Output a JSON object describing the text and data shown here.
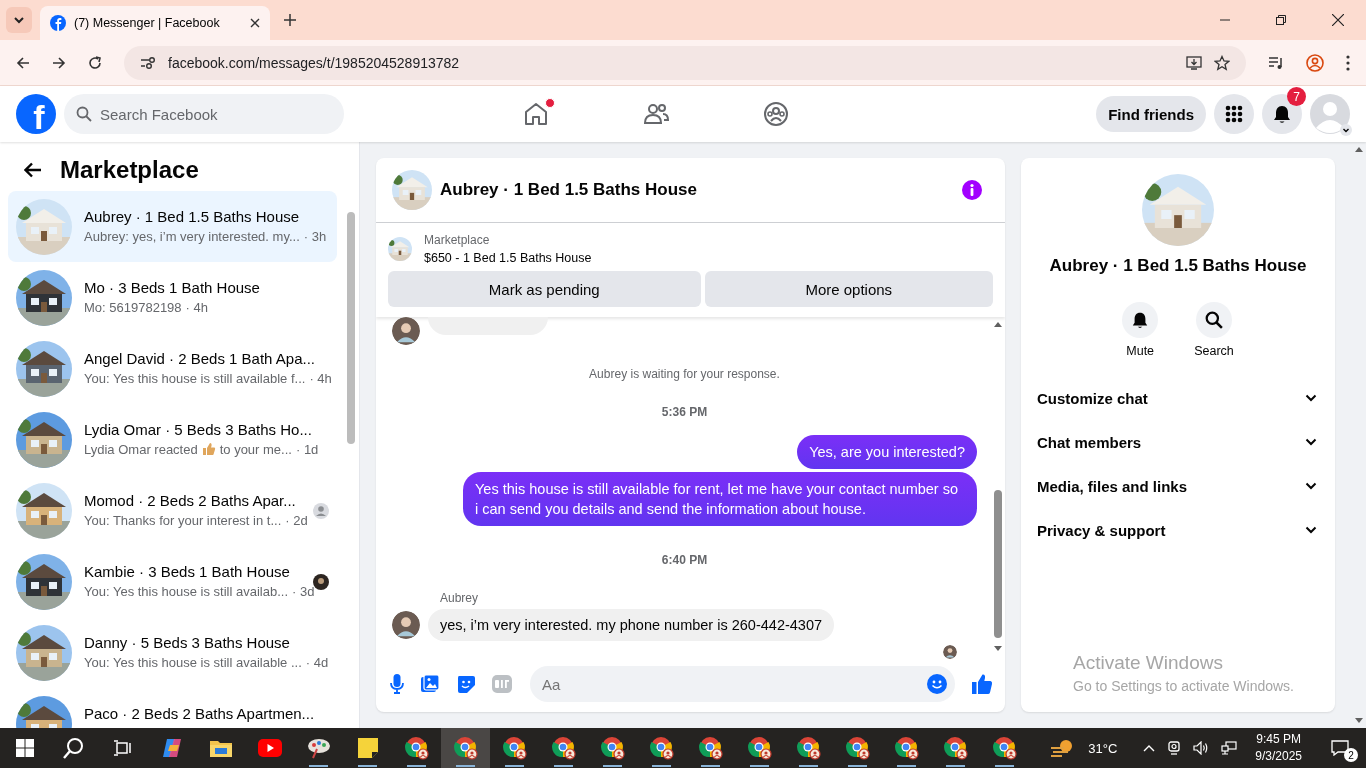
{
  "browser": {
    "tabs": [
      {
        "title": "(7) Messenger | Facebook",
        "selected": true
      }
    ],
    "url": "facebook.com/messages/t/1985204528913782"
  },
  "header": {
    "logo_text": "f",
    "search_placeholder": "Search Facebook",
    "nav": [
      {
        "kind": "home",
        "notification": true
      },
      {
        "kind": "friends",
        "notification": false
      },
      {
        "kind": "groups",
        "notification": false
      }
    ],
    "find_friends": "Find friends",
    "notification_count": "7"
  },
  "sidebar": {
    "title": "Marketplace",
    "conversations": [
      {
        "name": "Aubrey · 1 Bed 1.5 Baths House",
        "preview": "Aubrey: yes, i’m very interested. my...",
        "time": "· 3h",
        "selected": true,
        "reaction": false
      },
      {
        "name": "Mo · 3 Beds 1 Bath House",
        "preview": "Mo: 5619782198",
        "time": "· 4h",
        "selected": false,
        "reaction": false
      },
      {
        "name": "Angel David · 2 Beds 1 Bath Apa...",
        "preview": "You: Yes this house is still available f...",
        "time": "· 4h",
        "selected": false,
        "reaction": false
      },
      {
        "name": "Lydia Omar · 5 Beds 3 Baths Ho...",
        "preview": "Lydia Omar reacted",
        "preview_end": "to your me...",
        "time": "· 1d",
        "selected": false,
        "reaction": true
      },
      {
        "name": "Momod · 2 Beds 2 Baths Apar...",
        "preview": "You: Thanks for your interest in t...",
        "time": "· 2d",
        "selected": false,
        "reaction": false,
        "seen": {
          "kind": "icon"
        }
      },
      {
        "name": "Kambie · 3 Beds 1 Bath House",
        "preview": "You: Yes this house is still availab...",
        "time": "· 3d",
        "selected": false,
        "reaction": false,
        "seen": {
          "kind": "avatar"
        }
      },
      {
        "name": "Danny · 5 Beds 3 Baths House",
        "preview": "You: Yes this house is still available ...",
        "time": "· 4d",
        "selected": false,
        "reaction": false
      },
      {
        "name": "Paco · 2 Beds 2 Baths Apartmen...",
        "selected": false
      }
    ]
  },
  "chat": {
    "title": "Aubrey · 1 Bed 1.5 Baths House",
    "listing_label": "Marketplace",
    "listing_title": "$650 - 1 Bed 1.5 Baths House",
    "buttons": [
      "Mark as pending",
      "More options"
    ],
    "messages": [
      {
        "kind": "clipped"
      },
      {
        "kind": "notice",
        "text": "Aubrey is waiting for your response."
      },
      {
        "kind": "time",
        "text": "5:36 PM"
      },
      {
        "kind": "outgoing",
        "text": "Yes, are you interested?"
      },
      {
        "kind": "outgoing",
        "text": "Yes this house is still available for rent, let me have your contact number so i can send you details and send the information about house."
      },
      {
        "kind": "time",
        "text": "6:40 PM"
      },
      {
        "kind": "incoming",
        "sender": "Aubrey",
        "text": "yes, i’m very interested. my phone number is 260-442-4307"
      },
      {
        "kind": "receipt"
      }
    ],
    "composer_placeholder": "Aa"
  },
  "details": {
    "title": "Aubrey · 1 Bed 1.5 Baths House",
    "actions": [
      {
        "kind": "bell",
        "label": "Mute"
      },
      {
        "kind": "search",
        "label": "Search"
      }
    ],
    "sections": [
      "Customize chat",
      "Chat members",
      "Media, files and links",
      "Privacy & support"
    ]
  },
  "activation": {
    "title": "Activate Windows",
    "subtitle": "Go to Settings to activate Windows."
  },
  "taskbar": {
    "apps": [
      {
        "kind": "start",
        "running": false,
        "selected": false
      },
      {
        "kind": "search",
        "running": false,
        "selected": false
      },
      {
        "kind": "taskview",
        "running": false,
        "selected": false
      },
      {
        "kind": "copilot",
        "running": false,
        "selected": false
      },
      {
        "kind": "folder",
        "running": false,
        "selected": false
      },
      {
        "kind": "video",
        "running": false,
        "selected": false
      },
      {
        "kind": "paint",
        "running": true,
        "selected": false
      },
      {
        "kind": "notes",
        "running": true,
        "selected": false
      },
      {
        "kind": "browser",
        "running": true,
        "selected": false
      },
      {
        "kind": "browser",
        "running": true,
        "selected": true
      },
      {
        "kind": "browser",
        "running": true,
        "selected": false
      },
      {
        "kind": "browser",
        "running": true,
        "selected": false
      },
      {
        "kind": "browser",
        "running": true,
        "selected": false
      },
      {
        "kind": "browser",
        "running": true,
        "selected": false
      },
      {
        "kind": "browser",
        "running": true,
        "selected": false
      },
      {
        "kind": "browser",
        "running": true,
        "selected": false
      },
      {
        "kind": "browser",
        "running": true,
        "selected": false
      },
      {
        "kind": "browser",
        "running": true,
        "selected": false
      },
      {
        "kind": "browser",
        "running": true,
        "selected": false
      },
      {
        "kind": "browser",
        "running": true,
        "selected": false
      },
      {
        "kind": "browser",
        "running": true,
        "selected": false
      }
    ],
    "temperature": "31°C",
    "time": "9:45 PM",
    "date": "9/3/2025",
    "notification_count": "2"
  }
}
